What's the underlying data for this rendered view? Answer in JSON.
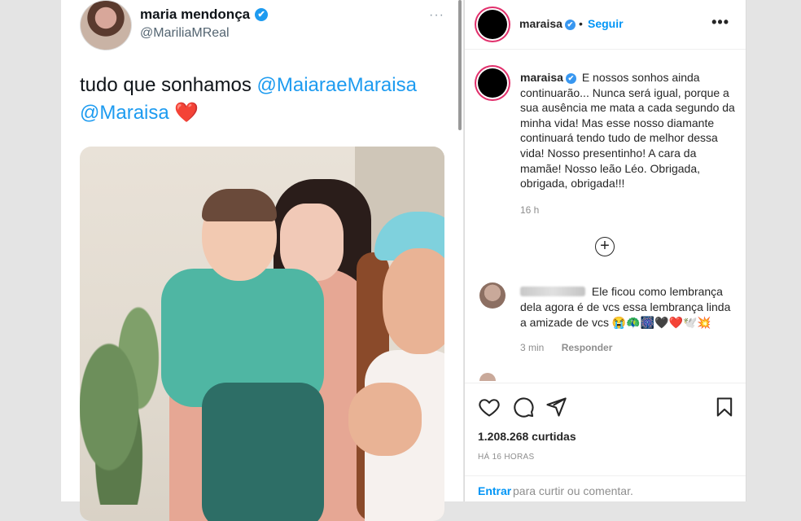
{
  "tweet": {
    "name": "maria mendonça",
    "handle": "@MariliaMReal",
    "text_prefix": "tudo que sonhamos",
    "mention_1": "@MaiaraeMaraisa",
    "mention_2": "@Maraisa",
    "heart": "❤️",
    "more": "···",
    "verified_glyph": "✔"
  },
  "instagram": {
    "header": {
      "username": "maraisa",
      "separator": "•",
      "follow_label": "Seguir",
      "more": "•••"
    },
    "caption": {
      "username": "maraisa",
      "text": "E nossos sonhos ainda continuarão... Nunca será igual, porque a sua ausência me mata a cada segundo da minha vida! Mas esse nosso diamante continuará tendo tudo de melhor dessa vida! Nosso presentinho! A cara da mamãe! Nosso leão Léo. Obrigada, obrigada, obrigada!!!",
      "time": "16 h"
    },
    "load_more_glyph": "+",
    "comment": {
      "text": "Ele ficou como lembrança dela agora é de vcs essa lembrança linda a amizade de vcs 😭🦚🎆🖤❤️🕊️💥",
      "time": "3 min",
      "reply_label": "Responder"
    },
    "likes": "1.208.268 curtidas",
    "age": "HÁ 16 HORAS",
    "login_link": "Entrar",
    "login_rest": "para curtir ou comentar."
  },
  "colors": {
    "ig_link": "#0095f6",
    "tweet_mention": "#1d9bf0",
    "verified": "#3897f0"
  }
}
